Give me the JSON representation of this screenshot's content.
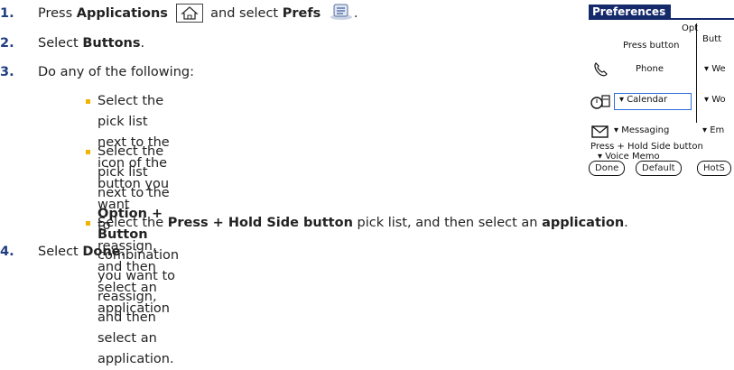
{
  "steps": [
    {
      "num": "1.",
      "text": {
        "a": "Press ",
        "b": "Applications",
        "c": " and select ",
        "d": "Prefs",
        "e": "."
      }
    },
    {
      "num": "2.",
      "text": {
        "a": "Select ",
        "b": "Buttons",
        "c": "."
      }
    },
    {
      "num": "3.",
      "text": {
        "a": "Do any of the following:"
      }
    },
    {
      "num": "4.",
      "text": {
        "a": "Select ",
        "b": "Done",
        "c": "."
      }
    }
  ],
  "bullets": [
    {
      "line1": "Select the pick list next to the icon of the button you want",
      "line2": "to reassign, and then select an application"
    },
    {
      "line1a": "Select the pick list next to the ",
      "line1b": "Option + Button",
      "line2": "combination you want to reassign, and then select an",
      "line3": "application."
    },
    {
      "a": "Select the ",
      "b": "Press + Hold Side button",
      "c": " pick list, and then select an ",
      "d": "application",
      "e": "."
    }
  ],
  "device": {
    "title": "Preferences",
    "col_press": "Press button",
    "col_opt1": "Opt",
    "col_opt2": "Butt",
    "row_phone": "Phone",
    "row_phone_opt": "▾ We",
    "row_calendar": "▾ Calendar",
    "row_calendar_opt": "▾ Wo",
    "row_messaging": "▾ Messaging",
    "row_messaging_opt": "▾ Em",
    "side_label": "Press + Hold Side button",
    "side_value": "▾ Voice Memo",
    "btn_done": "Done",
    "btn_default": "Default",
    "btn_hots": "HotS"
  },
  "colors": {
    "step_number": "#1f3d80",
    "bullet": "#f0b400",
    "title_bar": "#152a6a",
    "selection": "#2c6ee0"
  },
  "icons": {
    "applications": "home-icon",
    "prefs": "prefs-icon",
    "phone": "phone-icon",
    "calendar": "calendar-icon",
    "messaging": "envelope-icon"
  }
}
